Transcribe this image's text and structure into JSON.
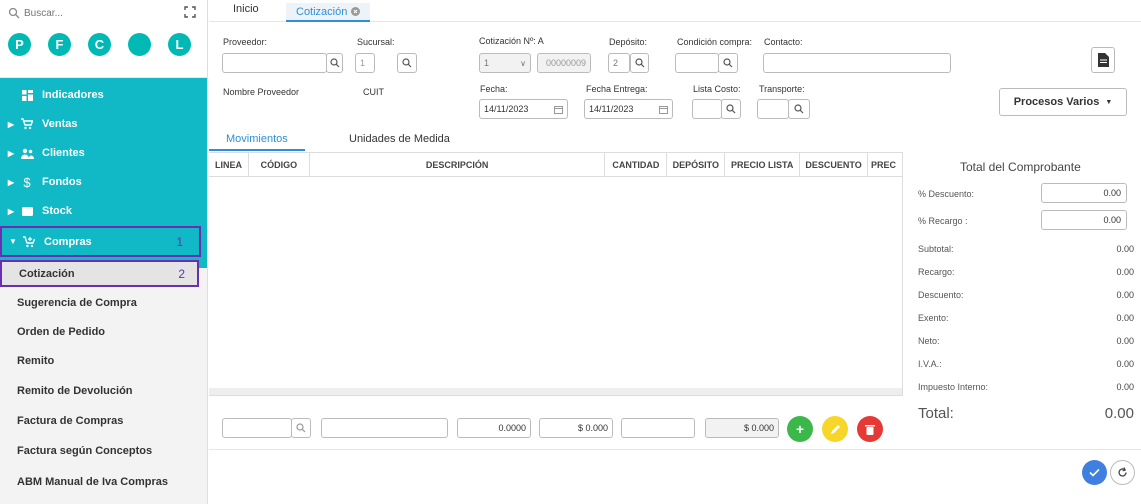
{
  "sidebar": {
    "search_placeholder": "Buscar...",
    "circles": [
      "P",
      "F",
      "C",
      "",
      "L"
    ],
    "menu": [
      {
        "label": "Indicadores",
        "icon": "dashboard-icon"
      },
      {
        "label": "Ventas",
        "icon": "cart-icon"
      },
      {
        "label": "Clientes",
        "icon": "people-icon"
      },
      {
        "label": "Fondos",
        "icon": "dollar-icon"
      },
      {
        "label": "Stock",
        "icon": "box-icon"
      },
      {
        "label": "Compras",
        "icon": "cart-plus-icon",
        "badge": "1"
      }
    ],
    "submenu": [
      {
        "label": "Cotización",
        "badge": "2"
      },
      {
        "label": "Sugerencia de Compra"
      },
      {
        "label": "Orden de Pedido"
      },
      {
        "label": "Remito"
      },
      {
        "label": "Remito de Devolución"
      },
      {
        "label": "Factura de Compras"
      },
      {
        "label": "Factura según Conceptos"
      },
      {
        "label": "ABM Manual de Iva Compras"
      }
    ]
  },
  "tabs": {
    "inicio": "Inicio",
    "cotizacion": "Cotización"
  },
  "form": {
    "proveedor": "Proveedor:",
    "sucursal": "Sucursal:",
    "sucursal_val": "1",
    "cotizacion_no": "Cotización Nº: A",
    "cotizacion_sel": "1",
    "cotizacion_num": "00000009",
    "deposito": "Depósito:",
    "deposito_val": "2",
    "condicion": "Condición compra:",
    "contacto": "Contacto:",
    "nombre_proveedor": "Nombre Proveedor",
    "cuit": "CUIT",
    "fecha": "Fecha:",
    "fecha_val": "14/11/2023",
    "fecha_entrega": "Fecha Entrega:",
    "fecha_entrega_val": "14/11/2023",
    "lista_costo": "Lista Costo:",
    "transporte": "Transporte:",
    "procesos": "Procesos Varios"
  },
  "subtabs": {
    "movimientos": "Movimientos",
    "unidades": "Unidades de Medida"
  },
  "grid_headers": [
    "LINEA",
    "CÓDIGO",
    "DESCRIPCIÓN",
    "CANTIDAD",
    "DEPÓSITO",
    "PRECIO LISTA",
    "DESCUENTO",
    "PREC"
  ],
  "bottom": {
    "cantidad": "0.0000",
    "precio": "$ 0.000",
    "total": "$ 0.000"
  },
  "totals": {
    "title": "Total del Comprobante",
    "descuento_pct": "% Descuento:",
    "descuento_pct_val": "0.00",
    "recargo_pct": "% Recargo :",
    "recargo_pct_val": "0.00",
    "rows": [
      {
        "label": "Subtotal:",
        "value": "0.00"
      },
      {
        "label": "Recargo:",
        "value": "0.00"
      },
      {
        "label": "Descuento:",
        "value": "0.00"
      },
      {
        "label": "Exento:",
        "value": "0.00"
      },
      {
        "label": "Neto:",
        "value": "0.00"
      },
      {
        "label": "I.V.A.:",
        "value": "0.00"
      },
      {
        "label": "Impuesto Interno:",
        "value": "0.00"
      }
    ],
    "total_label": "Total:",
    "total_val": "0.00"
  },
  "colors": {
    "teal": "#11b8c5",
    "accent": "#2d8fd9",
    "purple": "#6a2fb0",
    "green": "#3cb84b",
    "yellow": "#f5d629",
    "red": "#e53935",
    "blue": "#3f7fe0"
  }
}
